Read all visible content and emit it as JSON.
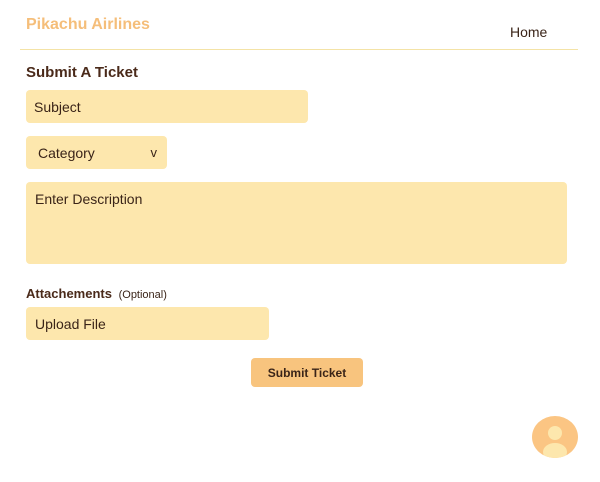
{
  "header": {
    "brand": "Pikachu Airlines",
    "nav": {
      "home_label": "Home"
    }
  },
  "form": {
    "title": "Submit A Ticket",
    "subject": {
      "placeholder": "Subject"
    },
    "category": {
      "selected": "Category",
      "chevron_glyph": "v"
    },
    "description": {
      "placeholder": "Enter Description"
    },
    "attachments": {
      "label": "Attachements",
      "optional_label": "(Optional)",
      "upload_label": "Upload File"
    },
    "submit_label": "Submit Ticket"
  },
  "colors": {
    "brand": "#f5be7a",
    "field_bg": "#fde7ad",
    "button_bg": "#f8c47e",
    "avatar_bg": "#fbc583",
    "text": "#3a2418"
  },
  "icons": {
    "avatar": "user-silhouette-icon",
    "dropdown": "chevron-down-icon"
  }
}
